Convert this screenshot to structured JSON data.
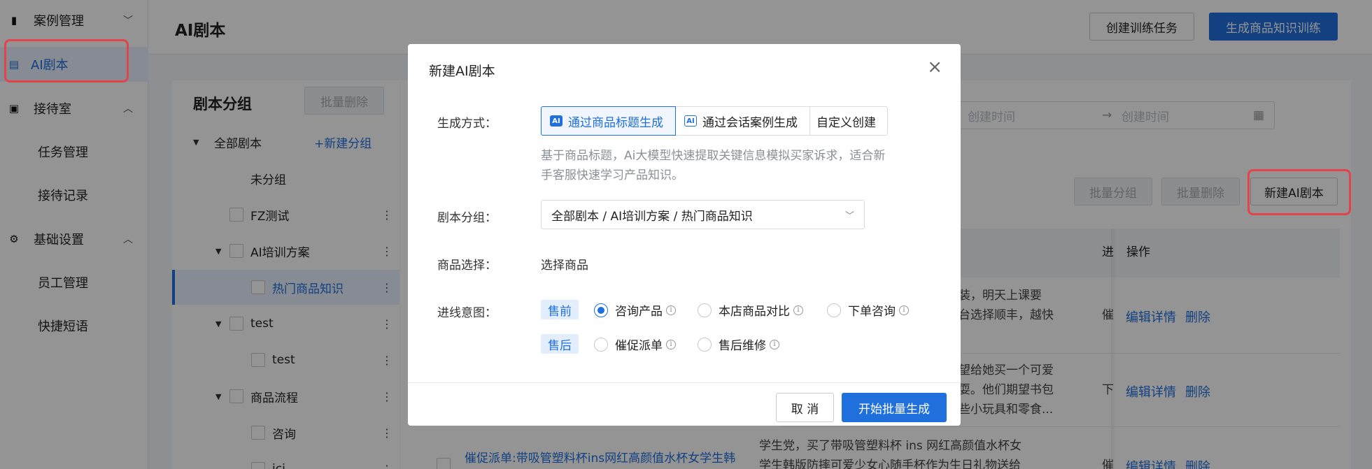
{
  "sidebar": {
    "items": [
      {
        "label": "案例管理",
        "chev": "﹀"
      },
      {
        "label": "AI剧本"
      },
      {
        "label": "接待室",
        "chev": "︿"
      },
      {
        "label": "任务管理"
      },
      {
        "label": "接待记录"
      },
      {
        "label": "基础设置",
        "chev": "︿"
      },
      {
        "label": "员工管理"
      },
      {
        "label": "快捷短语"
      }
    ]
  },
  "header": {
    "title": "AI剧本",
    "create_task_label": "创建训练任务",
    "generate_label": "生成商品知识训练"
  },
  "group_panel": {
    "title": "剧本分组",
    "batch_delete_label": "批量删除",
    "all_label": "全部剧本",
    "new_group_label": "+新建分组",
    "nodes": [
      "未分组",
      "FZ测试",
      "AI培训方案",
      "热门商品知识",
      "test",
      "test",
      "商品流程",
      "咨询",
      "ici"
    ]
  },
  "main": {
    "date_start_placeholder": "创建时间",
    "date_arrow": "→",
    "date_end_placeholder": "创建时间",
    "batch_group_label": "批量分组",
    "batch_delete_label": "批量删除",
    "new_ai_script_label": "新建AI剧本",
    "col_progress_short": "进",
    "col_ops": "操作",
    "rows": [
      {
        "line1": "装，明天上课要",
        "line2": "台选择顺丰，越快",
        "status": "催",
        "edit": "编辑详情",
        "delete": "删除"
      },
      {
        "line1": "望给她买一个可爱",
        "line2": "耍。他们期望书包",
        "line3": "些小玩具和零食...",
        "status": "下",
        "edit": "编辑详情",
        "delete": "删除"
      },
      {
        "title": "催促派单:带吸管塑料杯ins网红高颜值水杯女学生韩",
        "line1": "学生党，买了带吸管塑料杯 ins 网红高颜值水杯女",
        "line2": "学生韩版防摔可爱少女心随手杯作为生日礼物送给",
        "status": "催",
        "edit": "编辑详情",
        "delete": "删除"
      }
    ]
  },
  "modal": {
    "title": "新建AI剧本",
    "close": "×",
    "method_label": "生成方式：",
    "methods": [
      "通过商品标题生成",
      "通过会话案例生成",
      "自定义创建"
    ],
    "ai_badge": "AI",
    "description": "基于商品标题，Ai大模型快速提取关键信息模拟买家诉求，适合新手客服快速学习产品知识。",
    "group_label": "剧本分组：",
    "group_value": "全部剧本 / AI培训方案 / 热门商品知识",
    "product_label": "商品选择：",
    "product_link": "选择商品",
    "intent_label": "进线意图：",
    "presale_tag": "售前",
    "aftersale_tag": "售后",
    "presale_options": [
      "咨询产品",
      "本店商品对比",
      "下单咨询"
    ],
    "aftersale_options": [
      "催促派单",
      "售后维修"
    ],
    "selected_option": "咨询产品",
    "cancel_label": "取 消",
    "start_label": "开始批量生成"
  },
  "colors": {
    "primary": "#1f6fdc",
    "highlight_box": "#e3434b"
  }
}
